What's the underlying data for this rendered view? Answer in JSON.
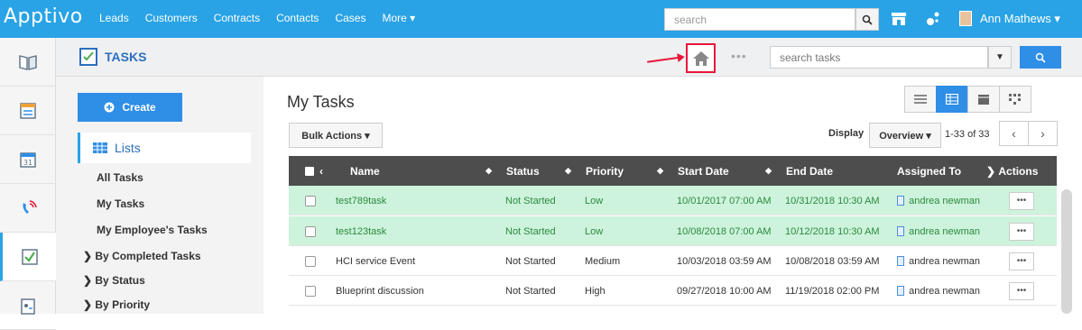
{
  "nav": {
    "logo": "Apptivo",
    "links": [
      "Leads",
      "Customers",
      "Contracts",
      "Contacts",
      "Cases",
      "More ▾"
    ],
    "search_placeholder": "search",
    "user": "Ann Mathews ▾"
  },
  "module": {
    "title": "TASKS",
    "search_placeholder": "search tasks"
  },
  "sidebar": {
    "create_label": "Create",
    "lists_label": "Lists",
    "items": [
      "All Tasks",
      "My Tasks",
      "My Employee's Tasks"
    ],
    "groups": [
      "By Completed Tasks",
      "By Status",
      "By Priority"
    ]
  },
  "main": {
    "title": "My Tasks",
    "bulk_actions": "Bulk Actions ▾",
    "display_label": "Display",
    "display_value": "Overview ▾",
    "pager": "1-33 of 33"
  },
  "table": {
    "columns": [
      "Name",
      "Status",
      "Priority",
      "Start Date",
      "End Date",
      "Assigned To",
      "Actions"
    ],
    "rows": [
      {
        "name": "test789task",
        "status": "Not Started",
        "priority": "Low",
        "start": "10/01/2017 07:00 AM",
        "end": "10/31/2018 10:30 AM",
        "assigned": "andrea newman",
        "highlight": true
      },
      {
        "name": "test123task",
        "status": "Not Started",
        "priority": "Low",
        "start": "10/08/2018 07:00 AM",
        "end": "10/12/2018 10:30 AM",
        "assigned": "andrea newman",
        "highlight": true
      },
      {
        "name": "HCI service Event",
        "status": "Not Started",
        "priority": "Medium",
        "start": "10/03/2018 03:59 AM",
        "end": "10/08/2018 03:59 AM",
        "assigned": "andrea newman",
        "highlight": false
      },
      {
        "name": "Blueprint discussion",
        "status": "Not Started",
        "priority": "High",
        "start": "09/27/2018 10:00 AM",
        "end": "11/19/2018 02:00 PM",
        "assigned": "andrea newman",
        "highlight": false
      }
    ]
  },
  "colors": {
    "brand": "#29a3e6",
    "accent": "#2f8ee6",
    "highlight": "#e8163b",
    "row_green": "#cdf3dc"
  }
}
